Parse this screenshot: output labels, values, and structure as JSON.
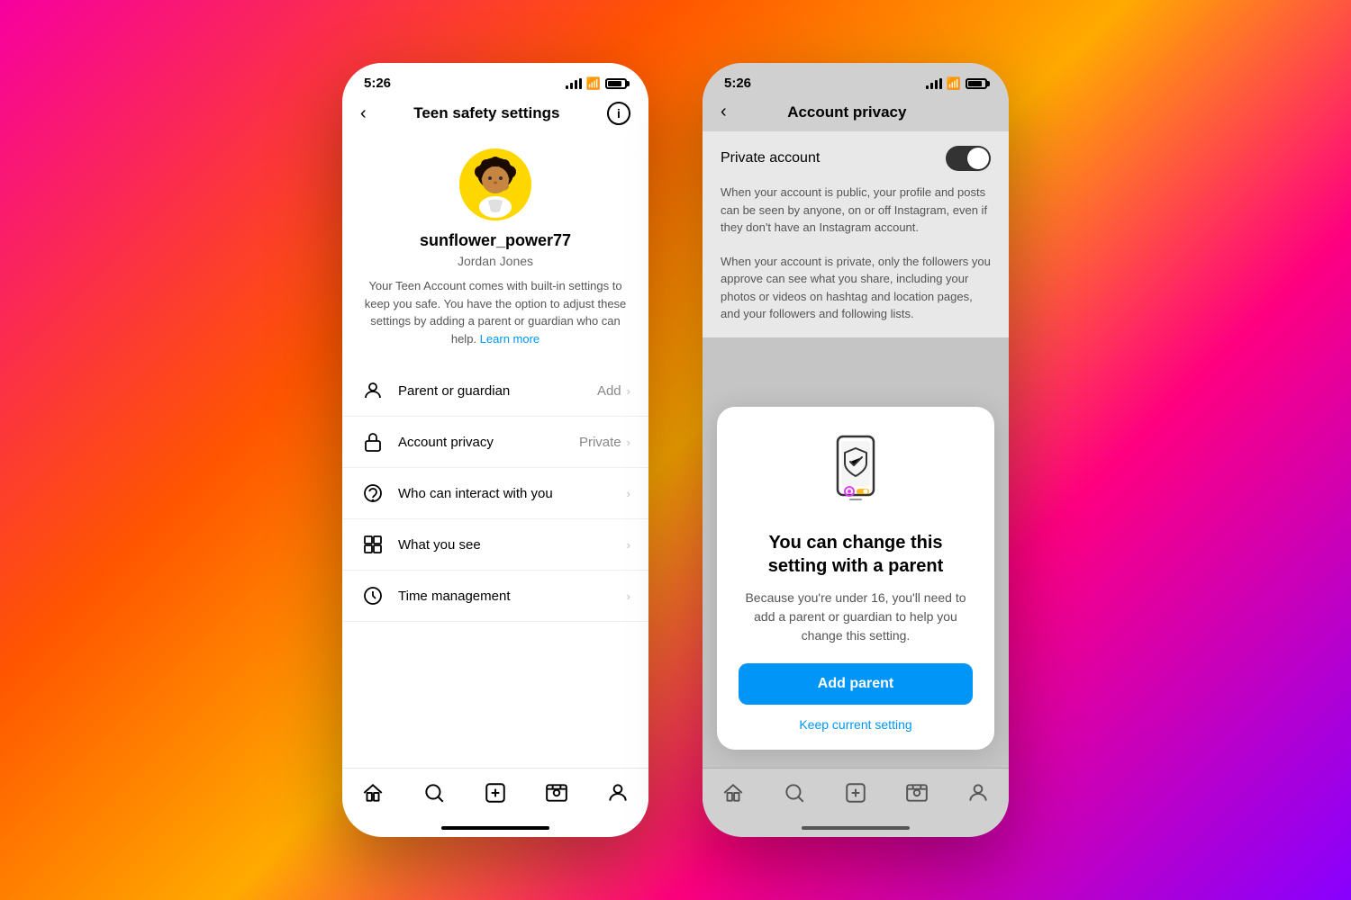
{
  "background": {
    "gradient": "linear-gradient(135deg, #f700a0, #ff5500, #ffaa00, #ff0080, #8800ff)"
  },
  "phone1": {
    "status_bar": {
      "time": "5:26"
    },
    "nav": {
      "title": "Teen safety settings",
      "back_label": "‹",
      "info_label": "i"
    },
    "profile": {
      "username": "sunflower_power77",
      "real_name": "Jordan Jones",
      "bio": "Your Teen Account comes with built-in settings to keep you safe. You have the option to adjust these settings by adding a parent or guardian who can help.",
      "learn_more": "Learn more"
    },
    "menu_items": [
      {
        "label": "Parent or guardian",
        "value": "Add",
        "icon": "person-icon"
      },
      {
        "label": "Account privacy",
        "value": "Private",
        "icon": "lock-icon"
      },
      {
        "label": "Who can interact with you",
        "value": "",
        "icon": "chat-icon"
      },
      {
        "label": "What you see",
        "value": "",
        "icon": "grid-icon"
      },
      {
        "label": "Time management",
        "value": "",
        "icon": "clock-icon"
      }
    ],
    "tab_bar": {
      "items": [
        "home-icon",
        "search-icon",
        "plus-icon",
        "reels-icon",
        "profile-icon"
      ]
    }
  },
  "phone2": {
    "status_bar": {
      "time": "5:26"
    },
    "nav": {
      "title": "Account privacy",
      "back_label": "‹"
    },
    "privacy": {
      "label": "Private account",
      "toggle_on": true,
      "description_public": "When your account is public, your profile and posts can be seen by anyone, on or on off Instagram, even if they don't have an Instagram account.",
      "description_private": "When your account is private, only the followers you approve can see what you share, including your photos or videos on hashtag and location pages, and your followers and following lists."
    },
    "modal": {
      "title": "You can change this setting with a parent",
      "description": "Because you're under 16, you'll need to add a parent or guardian to help you change this setting.",
      "add_parent_label": "Add parent",
      "keep_setting_label": "Keep current setting"
    },
    "tab_bar": {
      "items": [
        "home-icon",
        "search-icon",
        "plus-icon",
        "reels-icon",
        "profile-icon"
      ]
    }
  }
}
